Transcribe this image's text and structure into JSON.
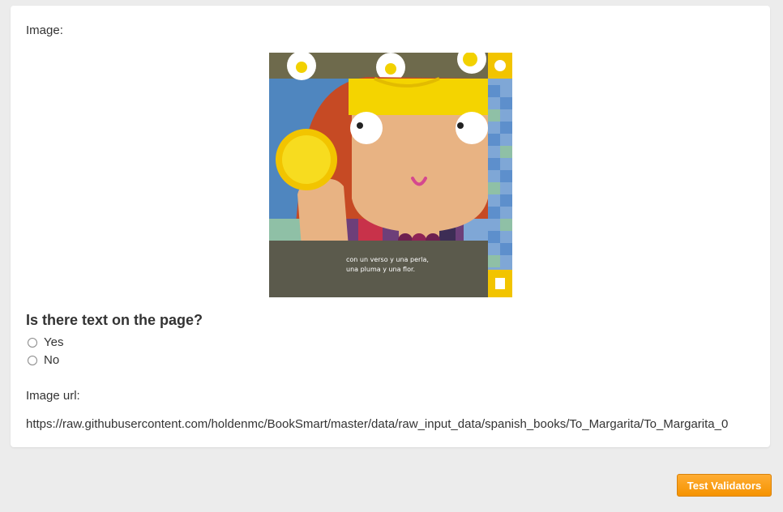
{
  "form": {
    "image_label": "Image:",
    "question": "Is there text on the page?",
    "options": [
      "Yes",
      "No"
    ],
    "image_url_label": "Image url:",
    "image_url": "https://raw.githubusercontent.com/holdenmc/BookSmart/master/data/raw_input_data/spanish_books/To_Margarita/To_Margarita_0"
  },
  "book_page": {
    "caption_line1": "con un verso y una perla,",
    "caption_line2": "una pluma y una flor."
  },
  "footer": {
    "button_label": "Test Validators"
  },
  "colors": {
    "button": "#f59300",
    "background": "#ececec",
    "card": "#ffffff"
  }
}
